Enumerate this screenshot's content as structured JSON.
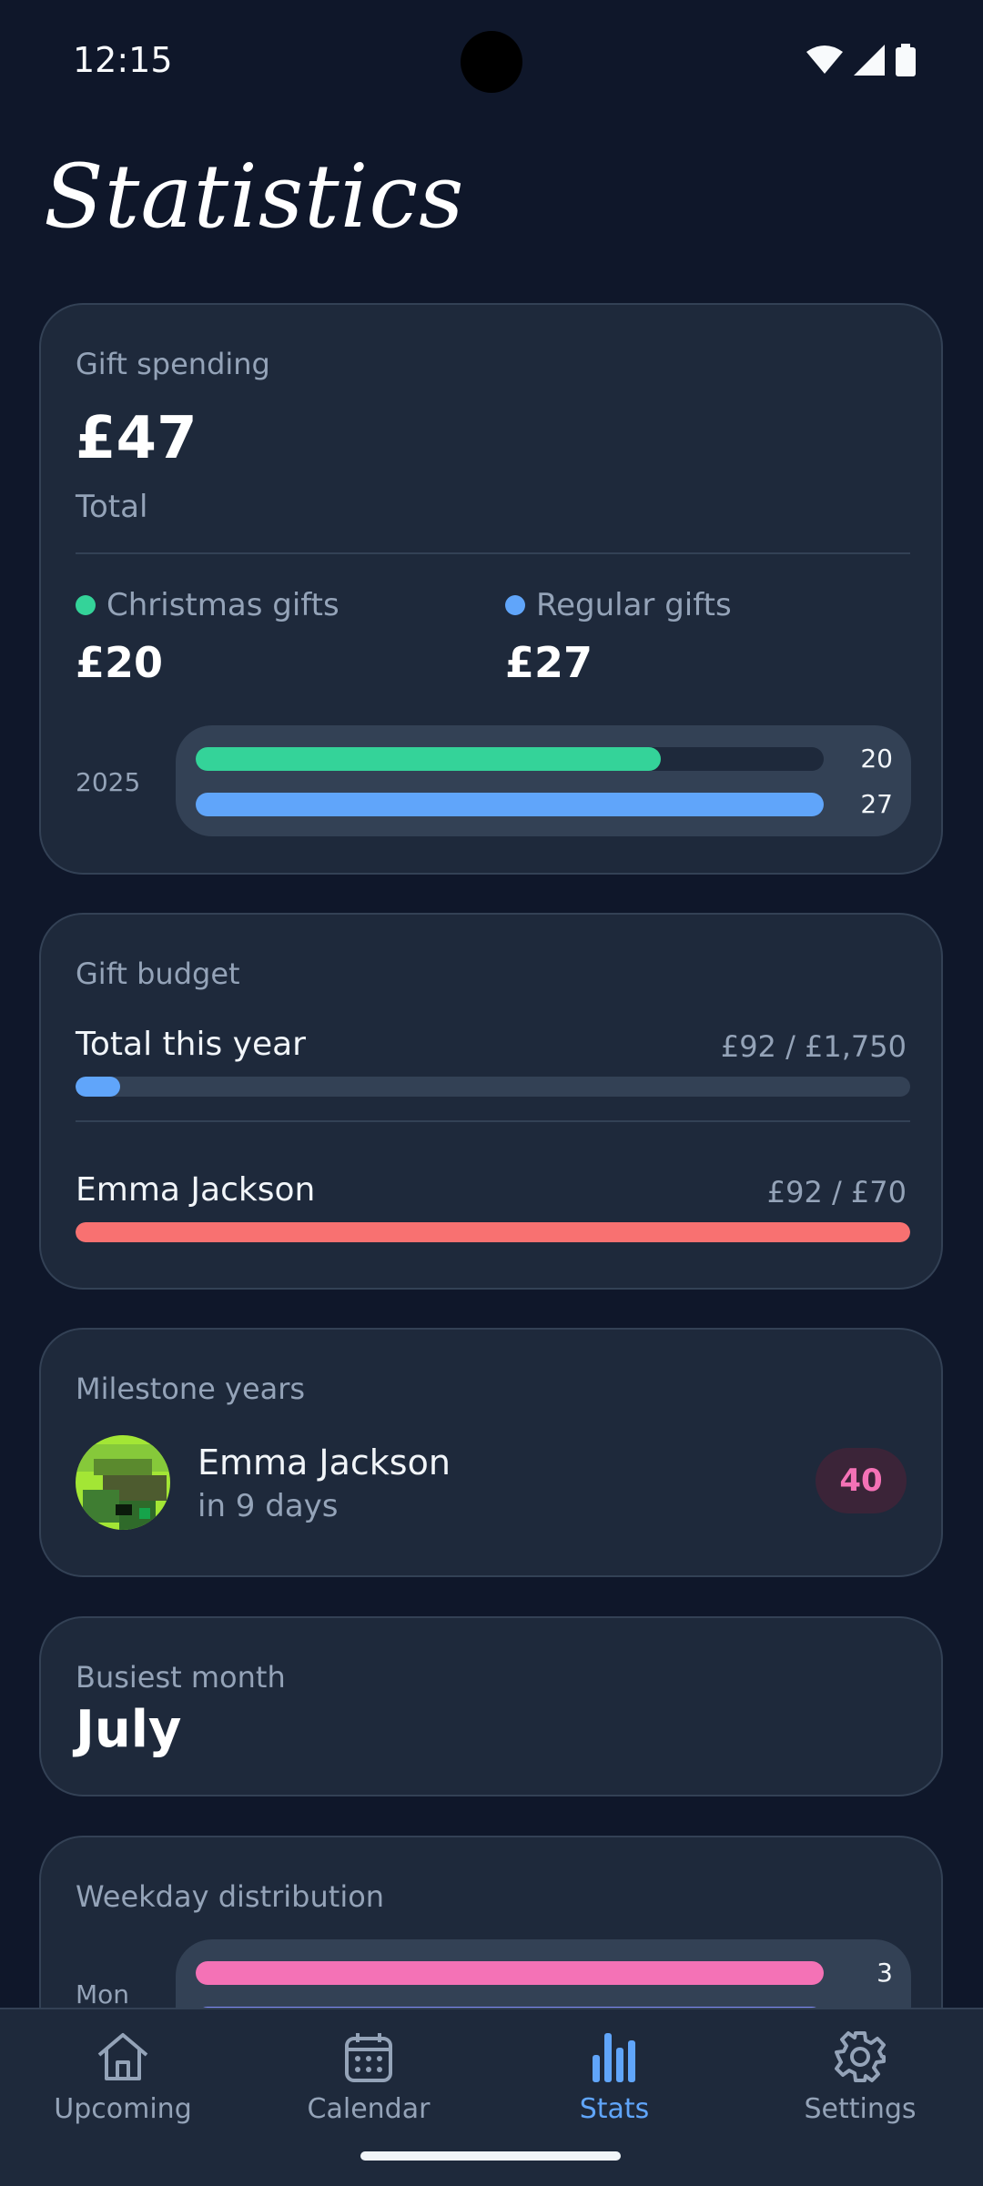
{
  "status": {
    "time": "12:15"
  },
  "page": {
    "title": "Statistics"
  },
  "spending": {
    "title": "Gift spending",
    "total": "£47",
    "total_label": "Total",
    "christmas_label": "Christmas gifts",
    "christmas_amount": "£20",
    "regular_label": "Regular gifts",
    "regular_amount": "£27",
    "year": "2025",
    "christmas_value": 20,
    "regular_value": 27,
    "christmas_value_text": "20",
    "regular_value_text": "27",
    "colors": {
      "christmas": "#34d399",
      "regular": "#60a5fa"
    }
  },
  "budget": {
    "title": "Gift budget",
    "total_label": "Total this year",
    "total_value": "£92 / £1,750",
    "total_fraction": 0.053,
    "person_name": "Emma Jackson",
    "person_value": "£92 / £70",
    "person_fraction": 1.0,
    "colors": {
      "total": "#60a5fa",
      "person": "#f87171"
    }
  },
  "milestone": {
    "title": "Milestone years",
    "name": "Emma Jackson",
    "sub": "in 9 days",
    "age": "40"
  },
  "busiest": {
    "label": "Busiest month",
    "value": "July"
  },
  "weekday": {
    "title": "Weekday distribution",
    "first_day": "Mon",
    "first_value": "3",
    "colors": {
      "bar1": "#f472b6",
      "bar2": "#818cf8"
    }
  },
  "nav": {
    "items": [
      {
        "label": "Upcoming",
        "icon": "home-icon"
      },
      {
        "label": "Calendar",
        "icon": "calendar-icon"
      },
      {
        "label": "Stats",
        "icon": "bar-chart-icon",
        "active": true
      },
      {
        "label": "Settings",
        "icon": "gear-icon"
      }
    ]
  }
}
